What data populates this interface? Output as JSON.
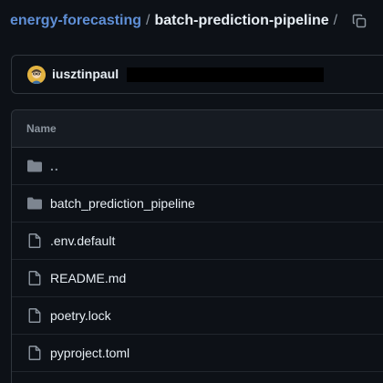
{
  "breadcrumb": {
    "repo": "energy-forecasting",
    "separator": "/",
    "current": "batch-prediction-pipeline",
    "trailing_separator": "/"
  },
  "copy_button": {
    "icon": "copy-icon"
  },
  "commit": {
    "author": "iusztinpaul",
    "avatar_color": "#e3b341"
  },
  "table": {
    "header": "Name",
    "rows": [
      {
        "name": "..",
        "type": "folder",
        "icon": "folder-icon"
      },
      {
        "name": "batch_prediction_pipeline",
        "type": "folder",
        "icon": "folder-icon"
      },
      {
        "name": ".env.default",
        "type": "file",
        "icon": "file-icon"
      },
      {
        "name": "README.md",
        "type": "file",
        "icon": "file-icon"
      },
      {
        "name": "poetry.lock",
        "type": "file",
        "icon": "file-icon"
      },
      {
        "name": "pyproject.toml",
        "type": "file",
        "icon": "file-icon"
      }
    ]
  },
  "colors": {
    "background": "#0d1117",
    "link": "#5f8fd6",
    "text": "#e6edf3",
    "muted": "#8b949e",
    "border": "#30363d",
    "folder": "#7d8590"
  }
}
